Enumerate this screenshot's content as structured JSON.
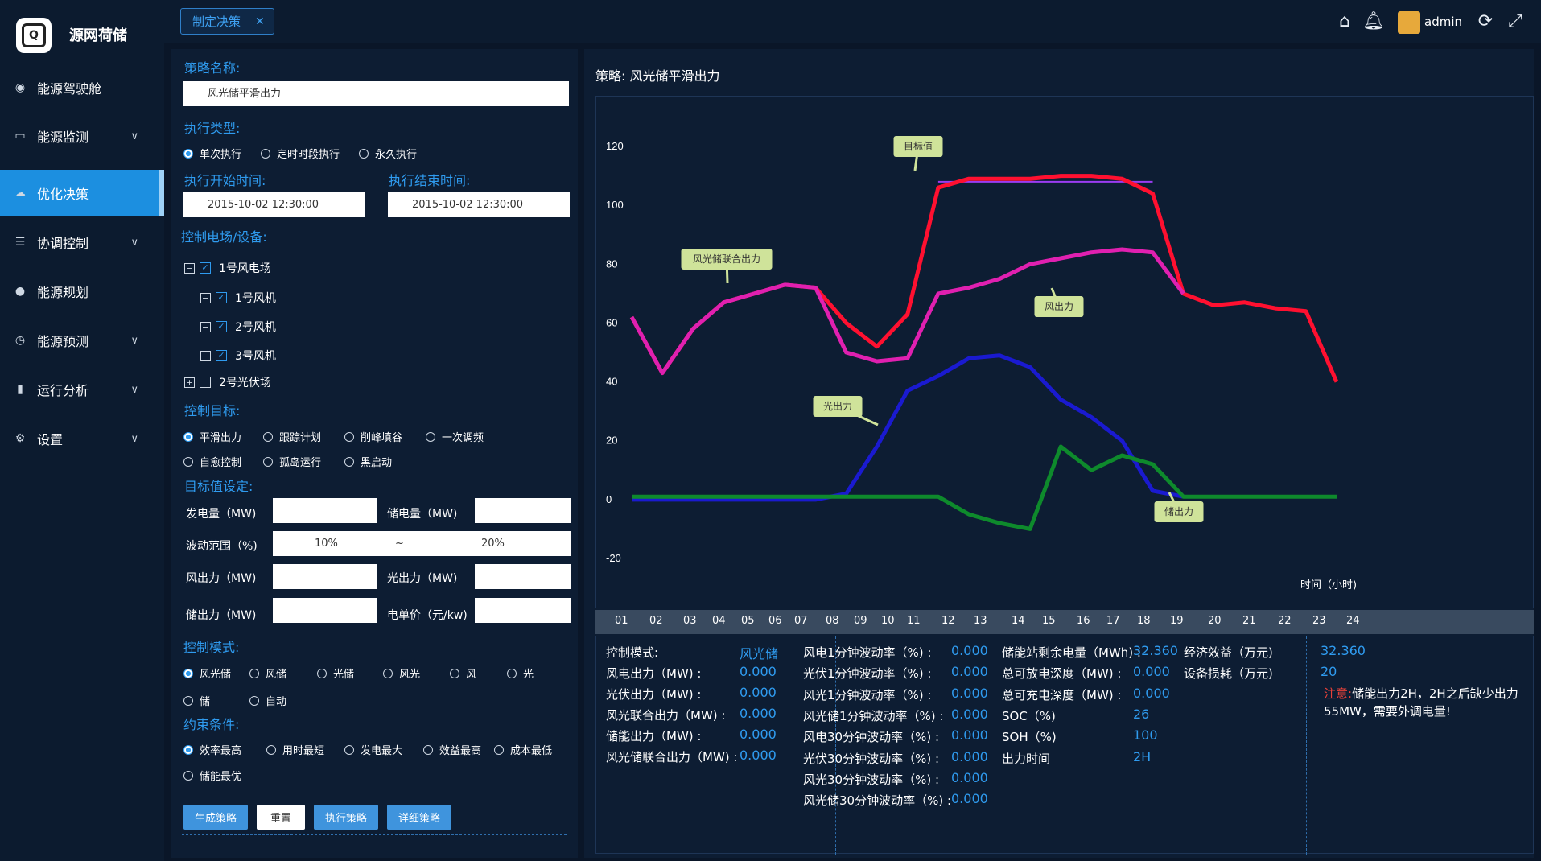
{
  "app": {
    "brand": "源网荷储",
    "logo_text": "Q"
  },
  "sidebar": {
    "items": [
      {
        "label": "能源驾驶舱",
        "icon": "dashboard-icon",
        "chevron": false
      },
      {
        "label": "能源监测",
        "icon": "monitor-icon",
        "chevron": true
      },
      {
        "label": "优化决策",
        "icon": "cloud-icon",
        "chevron": false,
        "active": true
      },
      {
        "label": "协调控制",
        "icon": "list-icon",
        "chevron": true
      },
      {
        "label": "能源规划",
        "icon": "dot-icon",
        "chevron": false
      },
      {
        "label": "能源预测",
        "icon": "clock-icon",
        "chevron": true
      },
      {
        "label": "运行分析",
        "icon": "bar-chart-icon",
        "chevron": true
      },
      {
        "label": "设置",
        "icon": "gear-icon",
        "chevron": true
      }
    ]
  },
  "topbar": {
    "tab_label": "制定决策",
    "user": "admin"
  },
  "form": {
    "strategy_name_label": "策略名称:",
    "strategy_name_value": "风光储平滑出力",
    "exec_type_label": "执行类型:",
    "exec_types": [
      "单次执行",
      "定时时段执行",
      "永久执行"
    ],
    "start_label": "执行开始时间:",
    "end_label": "执行结束时间:",
    "start_value": "2015-10-02   12:30:00",
    "end_value": "2015-10-02   12:30:00",
    "devices_label": "控制电场/设备:",
    "tree": [
      "1号风电场",
      "1号风机",
      "2号风机",
      "3号风机",
      "2号光伏场"
    ],
    "target_label": "控制目标:",
    "targets_row1": [
      "平滑出力",
      "跟踪计划",
      "削峰填谷",
      "一次调频"
    ],
    "targets_row2": [
      "自愈控制",
      "孤岛运行",
      "黑启动"
    ],
    "target_set_label": "目标值设定:",
    "gen_label": "发电量（MW)",
    "store_label": "储电量（MW)",
    "range_label": "波动范围（%)",
    "range_min": "10%",
    "range_sep": "~",
    "range_max": "20%",
    "wind_label": "风出力（MW)",
    "solar_label": "光出力（MW)",
    "storage_label": "储出力（MW)",
    "price_label": "电单价（元/kw)",
    "mode_label": "控制模式:",
    "modes_row1": [
      "风光储",
      "风储",
      "光储",
      "风光",
      "风",
      "光"
    ],
    "modes_row2": [
      "储",
      "自动"
    ],
    "constraint_label": "约束条件:",
    "constraints_row1": [
      "效率最高",
      "用时最短",
      "发电最大",
      "效益最高",
      "成本最低"
    ],
    "constraints_row2": [
      "储能最优"
    ],
    "buttons": [
      "生成策略",
      "重置",
      "执行策略",
      "详细策略"
    ]
  },
  "chart_header": {
    "title": "策略:  风光储平滑出力"
  },
  "chart_data": {
    "type": "line",
    "x": [
      "01",
      "02",
      "03",
      "04",
      "05",
      "06",
      "07",
      "08",
      "09",
      "10",
      "11",
      "12",
      "13",
      "14",
      "15",
      "16",
      "17",
      "18",
      "19",
      "20",
      "21",
      "22",
      "23",
      "24"
    ],
    "xlabel": "时间（小时)",
    "ylim": [
      -20,
      120
    ],
    "yticks": [
      120,
      100,
      80,
      60,
      40,
      20,
      0,
      -20
    ],
    "series": [
      {
        "name": "目标值",
        "color": "#9b3cf2",
        "values": [
          null,
          null,
          null,
          null,
          null,
          null,
          null,
          null,
          null,
          null,
          108,
          108,
          108,
          108,
          108,
          108,
          108,
          108,
          null,
          null,
          null,
          null,
          null,
          null
        ]
      },
      {
        "name": "风光储联合出力",
        "color": "#ff1030",
        "values": [
          62,
          43,
          58,
          67,
          70,
          73,
          72,
          60,
          52,
          63,
          106,
          109,
          109,
          109,
          110,
          110,
          109,
          104,
          70,
          66,
          67,
          65,
          64,
          40
        ]
      },
      {
        "name": "风出力",
        "color": "#e020b0",
        "values": [
          62,
          43,
          58,
          67,
          70,
          73,
          72,
          50,
          47,
          48,
          70,
          72,
          75,
          80,
          82,
          84,
          85,
          84,
          70,
          null,
          null,
          null,
          null,
          null
        ]
      },
      {
        "name": "光出力",
        "color": "#1a1ad0",
        "values": [
          0,
          0,
          0,
          0,
          0,
          0,
          0,
          2,
          18,
          37,
          42,
          48,
          49,
          45,
          34,
          28,
          20,
          3,
          1,
          null,
          null,
          null,
          null,
          null
        ]
      },
      {
        "name": "储出力",
        "color": "#0e8a2c",
        "values": [
          1,
          1,
          1,
          1,
          1,
          1,
          1,
          1,
          1,
          1,
          1,
          -5,
          -8,
          -10,
          18,
          10,
          15,
          12,
          1,
          1,
          1,
          1,
          1,
          1
        ]
      }
    ],
    "annotations": [
      "目标值",
      "风光储联合出力",
      "风出力",
      "光出力",
      "储出力"
    ]
  },
  "stats": {
    "col1": [
      {
        "label": "控制模式:",
        "value": "风光储"
      },
      {
        "label": "风电出力（MW) :",
        "value": "0.000"
      },
      {
        "label": "光伏出力（MW) :",
        "value": "0.000"
      },
      {
        "label": "风光联合出力（MW) :",
        "value": "0.000"
      },
      {
        "label": "储能出力（MW) :",
        "value": "0.000"
      },
      {
        "label": "风光储联合出力（MW) :",
        "value": "0.000"
      }
    ],
    "col2": [
      {
        "label": "风电1分钟波动率（%) :",
        "value": "0.000"
      },
      {
        "label": "光伏1分钟波动率（%) :",
        "value": "0.000"
      },
      {
        "label": "风光1分钟波动率（%) :",
        "value": "0.000"
      },
      {
        "label": "风光储1分钟波动率（%) :",
        "value": "0.000"
      },
      {
        "label": "风电30分钟波动率（%) :",
        "value": "0.000"
      },
      {
        "label": "光伏30分钟波动率（%) :",
        "value": "0.000"
      },
      {
        "label": "风光30分钟波动率（%) :",
        "value": "0.000"
      },
      {
        "label": "风光储30分钟波动率（%) :",
        "value": "0.000"
      }
    ],
    "col3": [
      {
        "label": "储能站剩余电量（MWh) :",
        "value": "32.360"
      },
      {
        "label": "总可放电深度（MW) :",
        "value": "0.000"
      },
      {
        "label": "总可充电深度（MW) :",
        "value": "0.000"
      },
      {
        "label": "SOC（%)",
        "value": "26"
      },
      {
        "label": "SOH（%)",
        "value": "100"
      },
      {
        "label": "出力时间",
        "value": "2H"
      }
    ],
    "col4": [
      {
        "label": "经济效益（万元)",
        "value": "32.360"
      },
      {
        "label": "设备损耗（万元)",
        "value": "20"
      }
    ],
    "note_prefix": "注意:",
    "note_text": "储能出力2H，2H之后缺少出力55MW，需要外调电量!"
  },
  "colors": {
    "accent": "#2f9bef",
    "active_nav": "#1c8fe0",
    "bg": "#0a1628",
    "panel": "#0d1d33"
  }
}
